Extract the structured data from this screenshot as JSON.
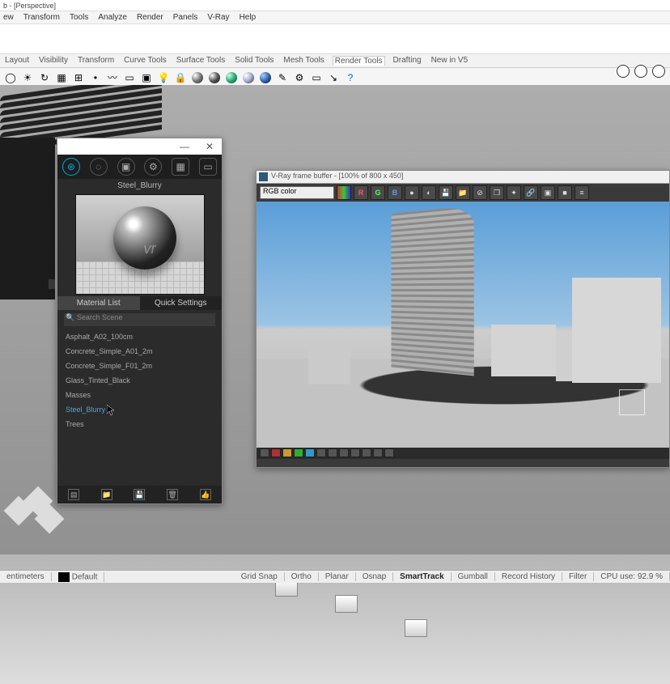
{
  "title": "b - [Perspective]",
  "menu": [
    "ew",
    "Transform",
    "Tools",
    "Analyze",
    "Render",
    "Panels",
    "V-Ray",
    "Help"
  ],
  "toolbar_tabs": [
    "Layout",
    "Visibility",
    "Transform",
    "Curve Tools",
    "Surface Tools",
    "Solid Tools",
    "Mesh Tools",
    "Render Tools",
    "Drafting",
    "New in V5"
  ],
  "vray": {
    "material_name": "Steel_Blurry",
    "tabs": [
      "Material List",
      "Quick Settings"
    ],
    "active_tab": 0,
    "search_placeholder": "Search Scene",
    "materials": [
      "Asphalt_A02_100cm",
      "Concrete_Simple_A01_2m",
      "Concrete_Simple_F01_2m",
      "Glass_Tinted_Black",
      "Masses",
      "Steel_Blurry",
      "Trees"
    ],
    "selected_material": "Steel_Blurry"
  },
  "framebuffer": {
    "title": "V-Ray frame buffer - [100% of 800 x 450]",
    "channel_select": "RGB color",
    "channels": [
      "R",
      "G",
      "B"
    ]
  },
  "status": {
    "units": "entimeters",
    "layer": "Default",
    "snaps": [
      "Grid Snap",
      "Ortho",
      "Planar",
      "Osnap",
      "SmartTrack",
      "Gumball",
      "Record History",
      "Filter"
    ],
    "active_snap": "SmartTrack",
    "cpu": "CPU use: 92.9 %"
  }
}
